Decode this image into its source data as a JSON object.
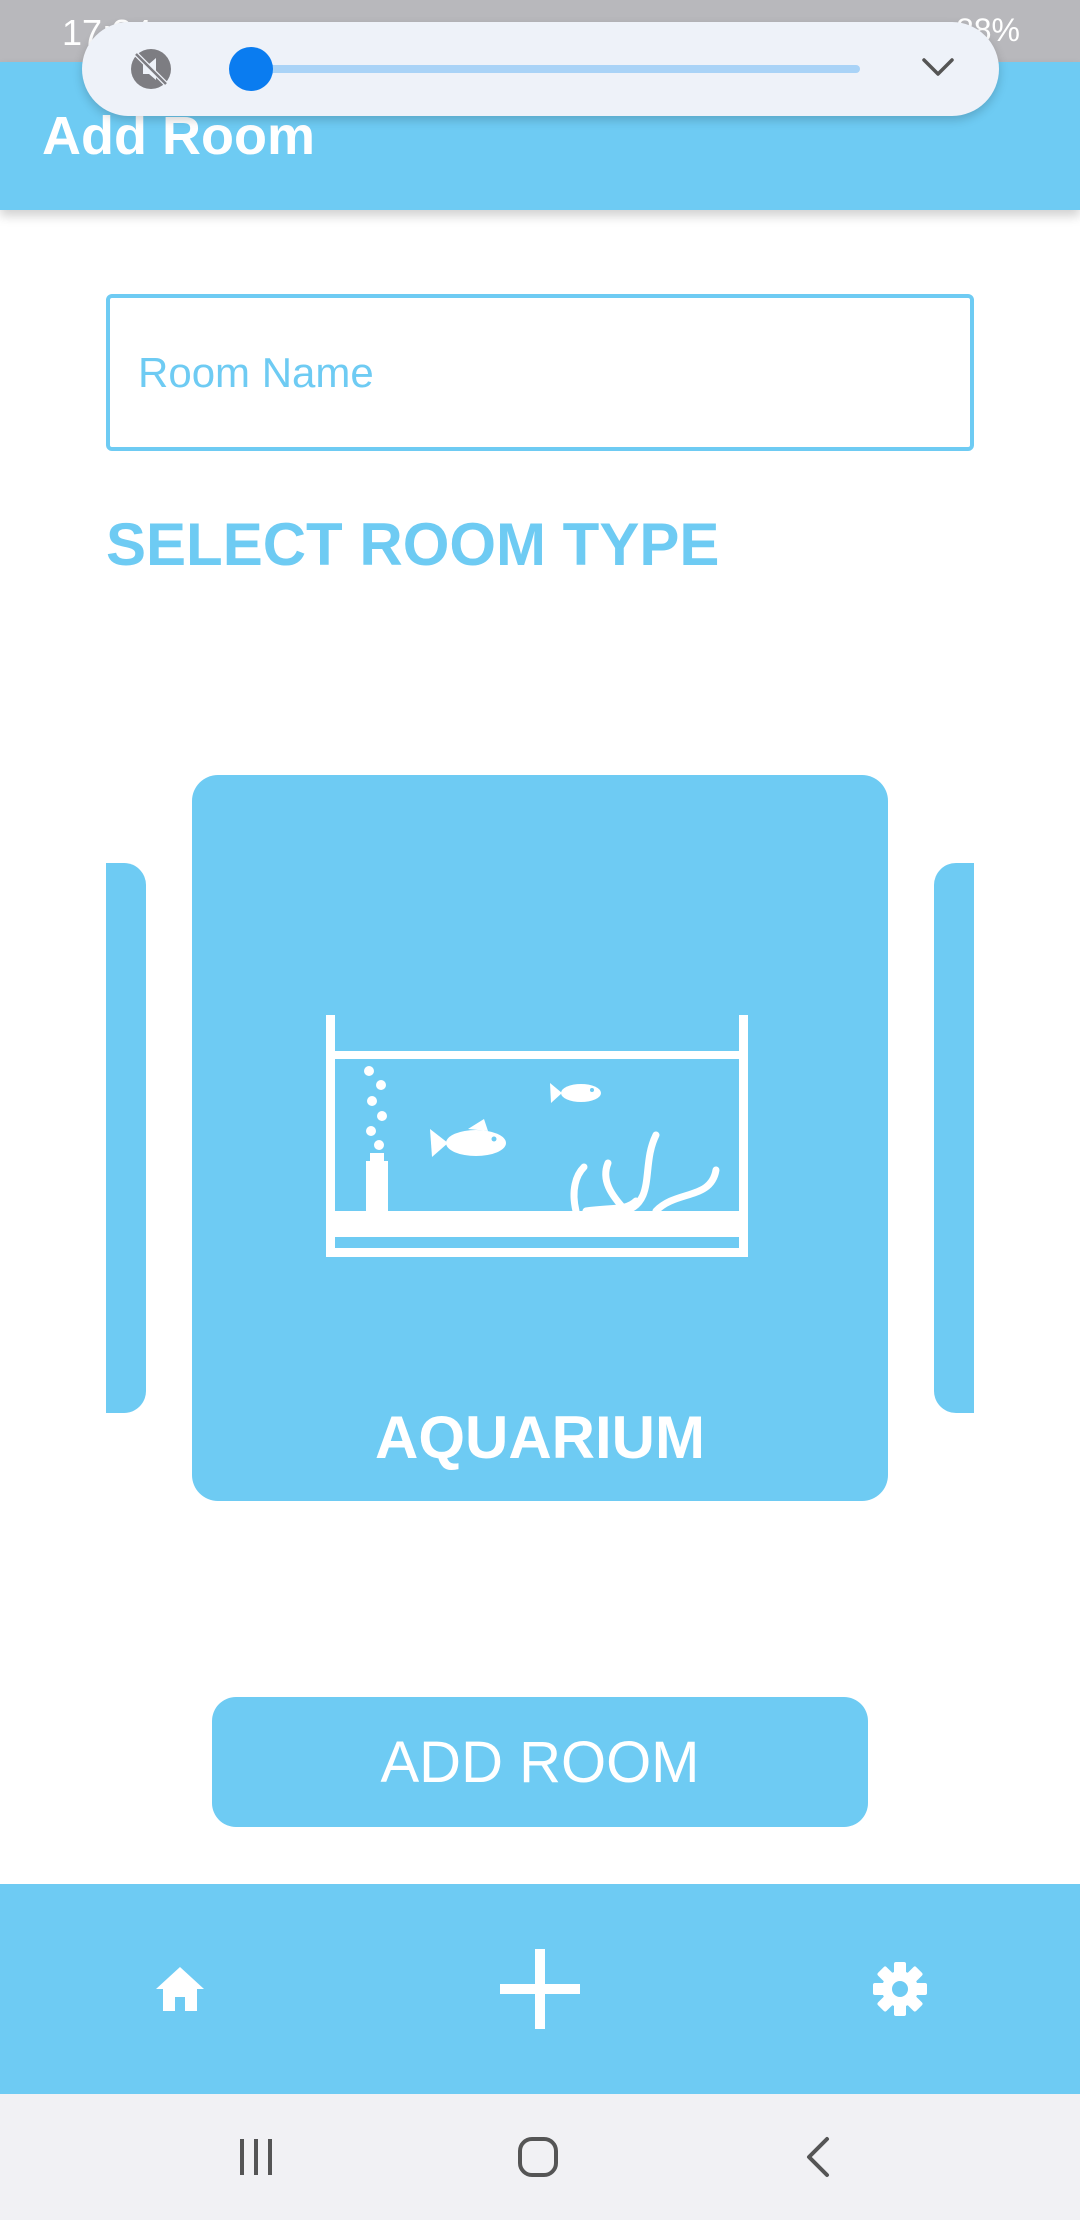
{
  "status_bar": {
    "time": "17:34",
    "battery": "88%"
  },
  "app_bar": {
    "title": "Add Room"
  },
  "media_control": {
    "volume_level": 0.03
  },
  "form": {
    "room_name_placeholder": "Room Name",
    "room_name_value": "",
    "section_title": "SELECT ROOM TYPE"
  },
  "carousel": {
    "selected_room_type": "AQUARIUM",
    "selected_icon": "aquarium-icon"
  },
  "actions": {
    "add_room_label": "ADD ROOM"
  },
  "bottom_nav": {
    "items": [
      {
        "icon": "home-icon"
      },
      {
        "icon": "plus-icon"
      },
      {
        "icon": "gear-icon"
      }
    ]
  },
  "system_nav": {
    "items": [
      "recents-icon",
      "home-circle-icon",
      "back-icon"
    ]
  },
  "colors": {
    "accent": "#6ecbf3",
    "slider_active": "#0a7cf0",
    "slider_track": "#a9d3f7",
    "pill_background": "#eef2f9",
    "system_nav_background": "#f1f1f4"
  }
}
